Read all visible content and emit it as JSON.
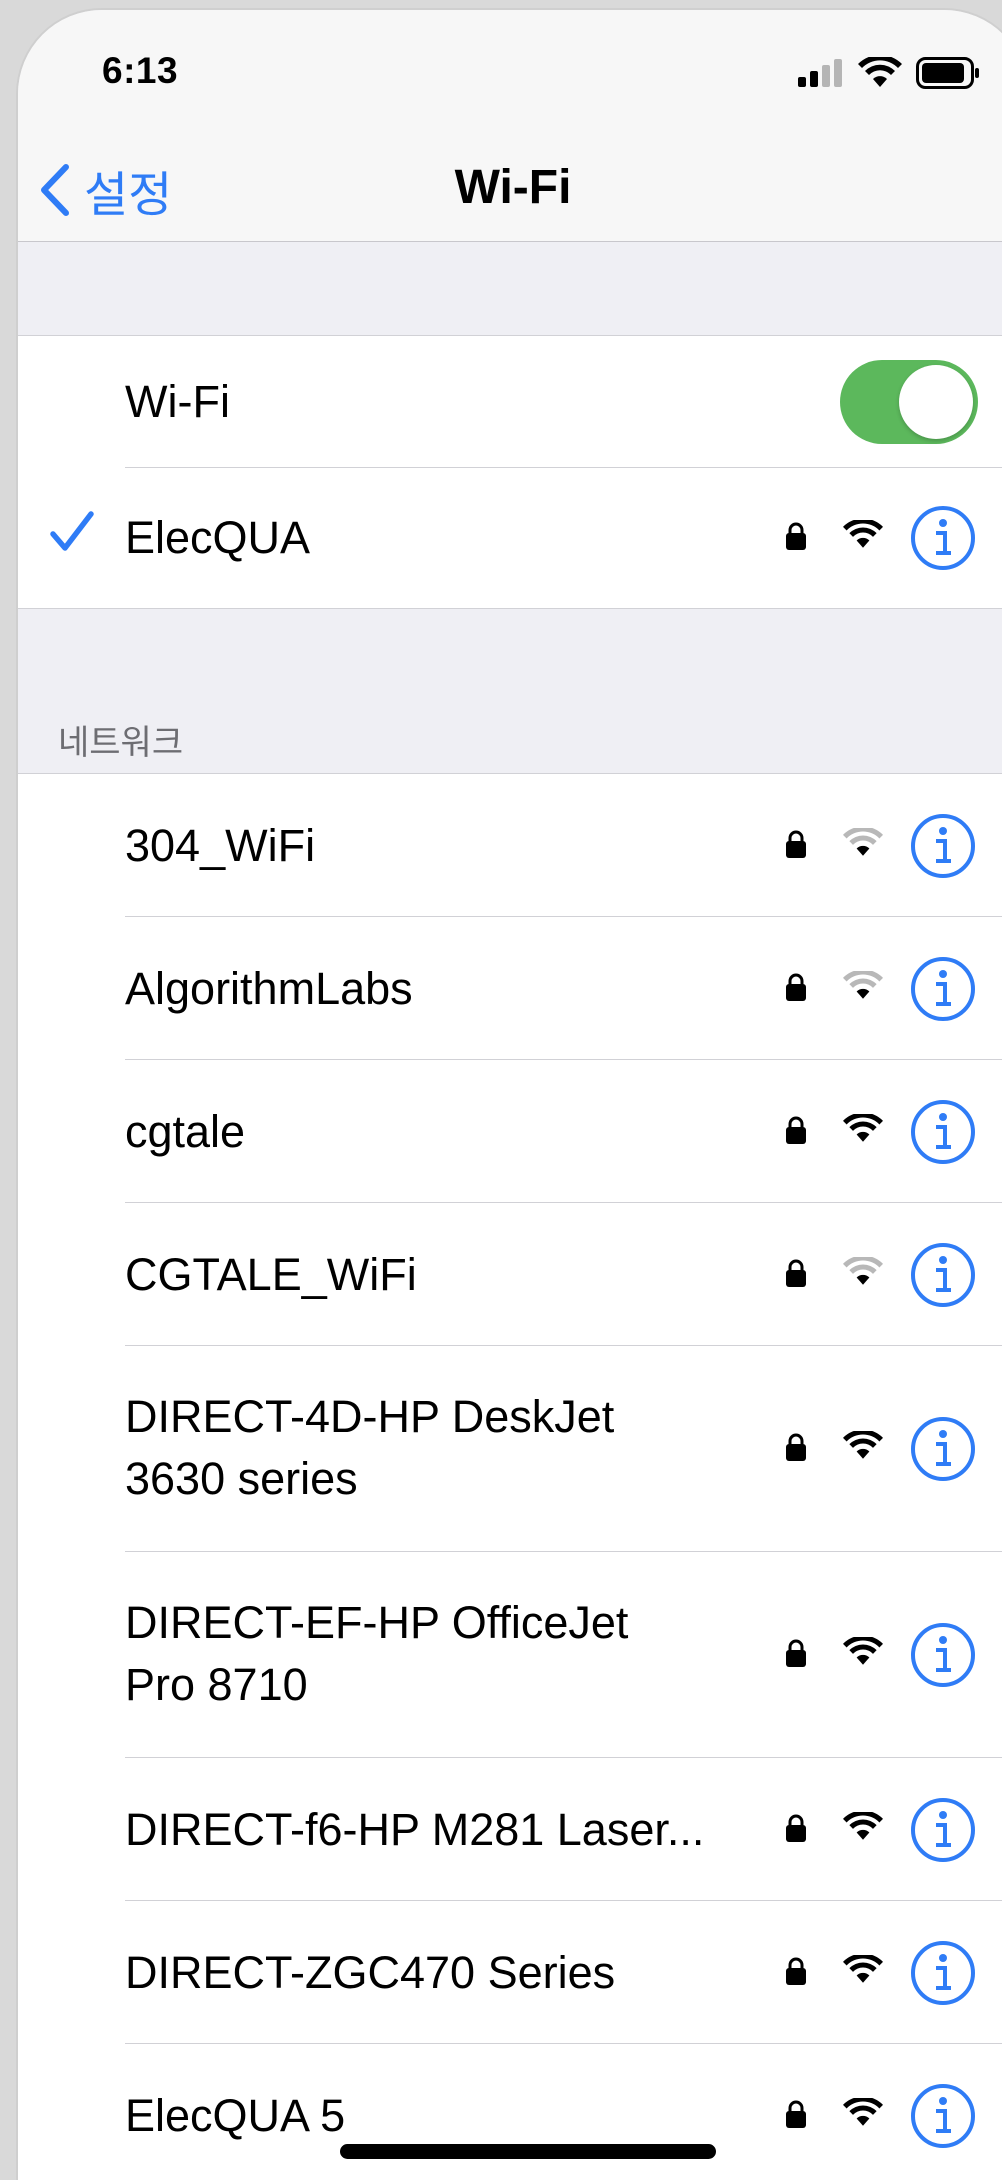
{
  "status_bar": {
    "time": "6:13"
  },
  "nav": {
    "back_label": "설정",
    "title": "Wi-Fi"
  },
  "wifi_toggle": {
    "label": "Wi-Fi",
    "on": true
  },
  "connected": {
    "name": "ElecQUA",
    "locked": true,
    "signal": "full"
  },
  "networks_header": "네트워크",
  "networks": [
    {
      "name": "304_WiFi",
      "locked": true,
      "signal": "weak"
    },
    {
      "name": "AlgorithmLabs",
      "locked": true,
      "signal": "weak"
    },
    {
      "name": "cgtale",
      "locked": true,
      "signal": "full"
    },
    {
      "name": "CGTALE_WiFi",
      "locked": true,
      "signal": "weak"
    },
    {
      "name": "DIRECT-4D-HP DeskJet 3630 series",
      "line1": "DIRECT-4D-HP DeskJet",
      "line2": "3630 series",
      "locked": true,
      "signal": "full"
    },
    {
      "name": "DIRECT-EF-HP OfficeJet Pro 8710",
      "line1": "DIRECT-EF-HP OfficeJet",
      "line2": "Pro 8710",
      "locked": true,
      "signal": "full"
    },
    {
      "name": "DIRECT-f6-HP M281 Laser...",
      "locked": true,
      "signal": "full"
    },
    {
      "name": "DIRECT-ZGC470 Series",
      "locked": true,
      "signal": "full"
    },
    {
      "name": "ElecQUA 5",
      "locked": true,
      "signal": "full"
    }
  ],
  "icons": {
    "back": "chevron-left-icon",
    "check": "checkmark-icon",
    "lock": "lock-icon",
    "wifi": "wifi-icon",
    "info": "info-icon",
    "cellular": "cellular-signal-icon",
    "battery": "battery-icon"
  },
  "colors": {
    "accent": "#2f7cf6",
    "toggle_on": "#5cb85c",
    "background": "#efeff4"
  }
}
